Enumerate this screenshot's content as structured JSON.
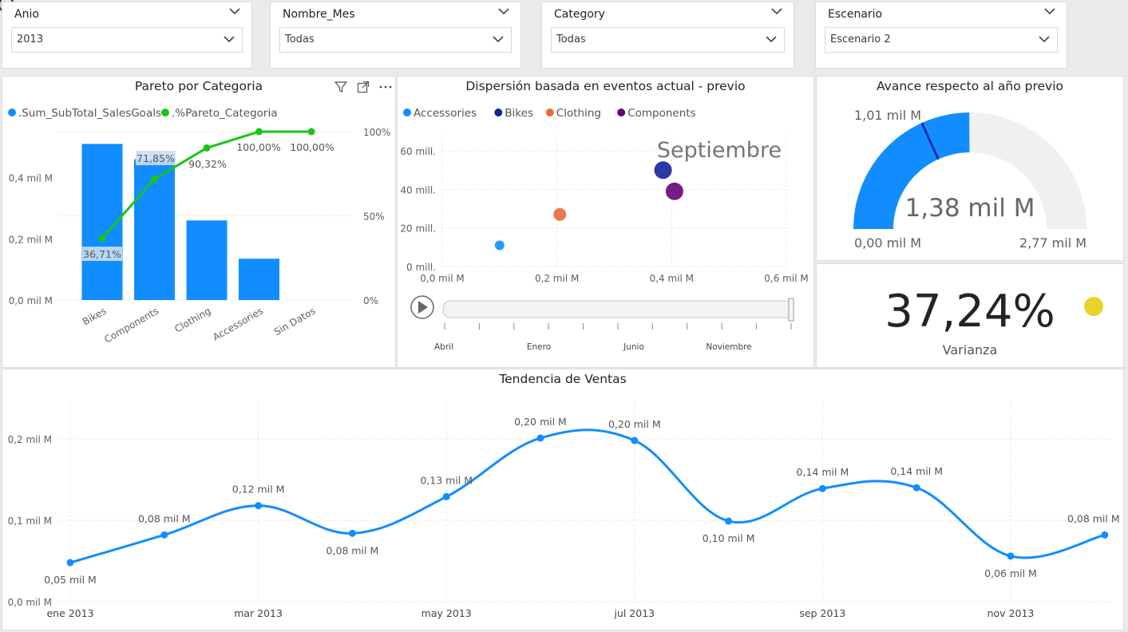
{
  "slicers": [
    {
      "title": "Anio",
      "value": "2013"
    },
    {
      "title": "Nombre_Mes",
      "value": "Todas"
    },
    {
      "title": "Category",
      "value": "Todas"
    },
    {
      "title": "Escenario",
      "value": "Escenario 2"
    }
  ],
  "pareto": {
    "title": "Pareto por Categoria",
    "chart_data": {
      "type": "bar",
      "categories": [
        "Bikes",
        "Components",
        "Clothing",
        "Accessories",
        "Sin Datos"
      ],
      "series": [
        {
          "name": ".Sum_SubTotal_SalesGoals",
          "values": [
            0.51,
            0.46,
            0.26,
            0.135,
            0
          ]
        },
        {
          "name": ".%Pareto_Categoria",
          "values": [
            36.71,
            71.85,
            90.32,
            100,
            100
          ]
        }
      ],
      "data_labels": [
        "36,71%",
        "71,85%",
        "90,32%",
        "100,00%",
        "100,00%"
      ],
      "y_ticks": [
        "0,0 mil M",
        "0,2 mil M",
        "0,4 mil M"
      ],
      "y2_ticks": [
        "0%",
        "50%",
        "100%"
      ],
      "ylim": [
        0,
        0.55
      ],
      "y2lim": [
        0,
        100
      ],
      "colors": {
        "bar": "#118DFF",
        "line": "#1AC41A"
      }
    }
  },
  "scatter": {
    "title": "Dispersión basada en eventos actual - previo",
    "annotation": "Septiembre",
    "chart_data": {
      "type": "scatter",
      "series": [
        {
          "name": "Accessories",
          "color": "#118DFF",
          "points": [
            [
              0.1,
              11
            ]
          ],
          "size": 6
        },
        {
          "name": "Bikes",
          "color": "#12239E",
          "points": [
            [
              0.385,
              50
            ]
          ],
          "size": 11
        },
        {
          "name": "Clothing",
          "color": "#E66C37",
          "points": [
            [
              0.205,
              27
            ]
          ],
          "size": 8
        },
        {
          "name": "Components",
          "color": "#6B007B",
          "points": [
            [
              0.405,
              39
            ]
          ],
          "size": 11
        }
      ],
      "x_ticks": [
        "0,0 mil M",
        "0,2 mil M",
        "0,4 mil M",
        "0,6 mil M"
      ],
      "y_ticks": [
        "0 mill.",
        "20 mill.",
        "40 mill.",
        "60 mill."
      ],
      "xlim": [
        0,
        0.6
      ],
      "ylim": [
        0,
        60
      ]
    },
    "play_axis": {
      "labels": [
        "Abril",
        "Enero",
        "Junio",
        "Noviembre"
      ],
      "tick_count": 11,
      "position": 1.0
    }
  },
  "gauge": {
    "title": "Avance respecto al año previo",
    "value_label": "1,38 mil M",
    "min_label": "0,00 mil M",
    "max_label": "2,77 mil M",
    "target_label": "1,01 mil M",
    "value": 1.38,
    "min": 0,
    "max": 2.77,
    "target": 1.01,
    "colors": {
      "fill": "#118DFF",
      "track": "#F0F0F0",
      "target": "#12239E"
    }
  },
  "card": {
    "value": "37,24%",
    "label": "Varianza",
    "indicator_color": "#E8D42A"
  },
  "trend": {
    "title": "Tendencia de Ventas",
    "chart_data": {
      "type": "line",
      "x": [
        "ene 2013",
        "feb 2013",
        "mar 2013",
        "abr 2013",
        "may 2013",
        "jun 2013",
        "jul 2013",
        "ago 2013",
        "sep 2013",
        "oct 2013",
        "nov 2013",
        "dic 2013"
      ],
      "values": [
        0.048,
        0.082,
        0.118,
        0.084,
        0.129,
        0.201,
        0.198,
        0.099,
        0.139,
        0.14,
        0.056,
        0.082
      ],
      "data_labels": [
        "0,05 mil M",
        "0,08 mil M",
        "0,12 mil M",
        "0,08 mil M",
        "0,13 mil M",
        "0,20 mil M",
        "0,20 mil M",
        "0,10 mil M",
        "0,14 mil M",
        "0,14 mil M",
        "0,06 mil M",
        "0,08 mil M"
      ],
      "x_ticks": [
        "ene 2013",
        "mar 2013",
        "may 2013",
        "jul 2013",
        "sep 2013",
        "nov 2013"
      ],
      "y_ticks": [
        "0,0 mil M",
        "0,1 mil M",
        "0,2 mil M"
      ],
      "ylim": [
        0,
        0.2
      ],
      "color": "#118DFF"
    }
  }
}
